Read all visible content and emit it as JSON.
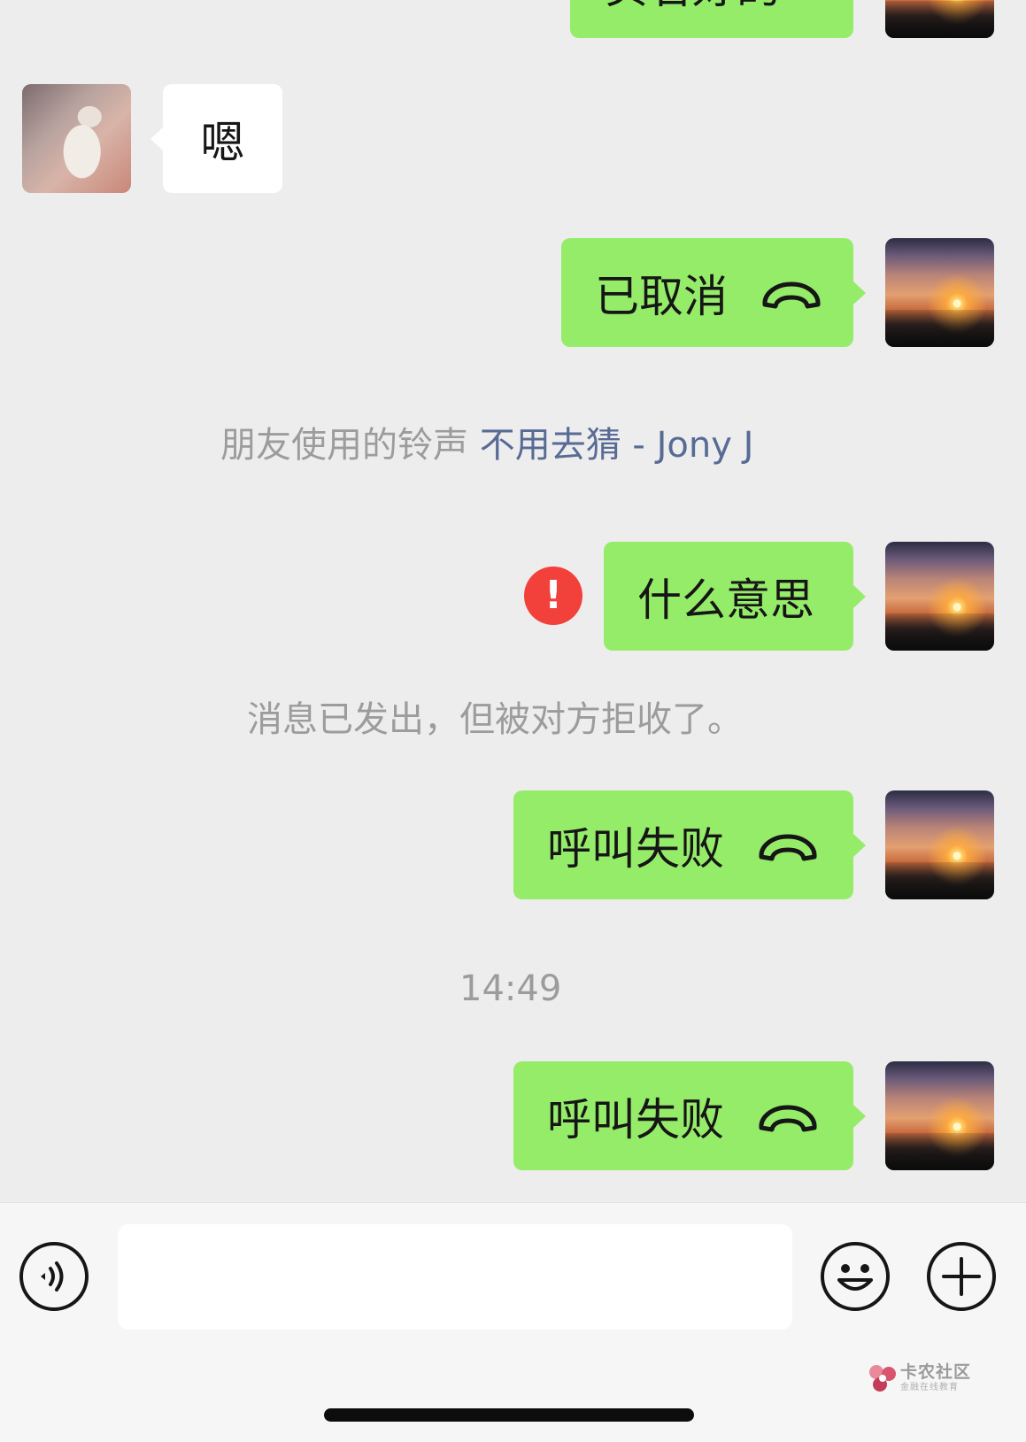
{
  "messages": {
    "top_partial": {
      "text": "实名好的"
    },
    "reply_en": {
      "text": "嗯"
    },
    "call_cancelled": {
      "text": "已取消"
    },
    "ringtone_notice": {
      "prefix": "朋友使用的铃声",
      "song": "不用去猜 - Jony J"
    },
    "failed_message": {
      "text": "什么意思"
    },
    "rejected_notice": {
      "text": "消息已发出，但被对方拒收了。"
    },
    "call_failed_1": {
      "text": "呼叫失败"
    },
    "timestamp": {
      "text": "14:49"
    },
    "call_failed_2": {
      "text": "呼叫失败"
    }
  },
  "icons": {
    "phone": "phone-hangup-icon",
    "error": "error-exclamation-icon",
    "voice": "voice-icon",
    "emoji": "emoji-icon",
    "plus": "plus-icon"
  },
  "error_mark": "!",
  "input": {
    "placeholder": ""
  },
  "watermark": {
    "main": "卡农社区",
    "sub": "金融在线教育"
  },
  "colors": {
    "background": "#ededed",
    "sent_bubble": "#95ec69",
    "received_bubble": "#ffffff",
    "link": "#576b95",
    "system_text": "#9c9c9c",
    "error": "#f2413b"
  }
}
